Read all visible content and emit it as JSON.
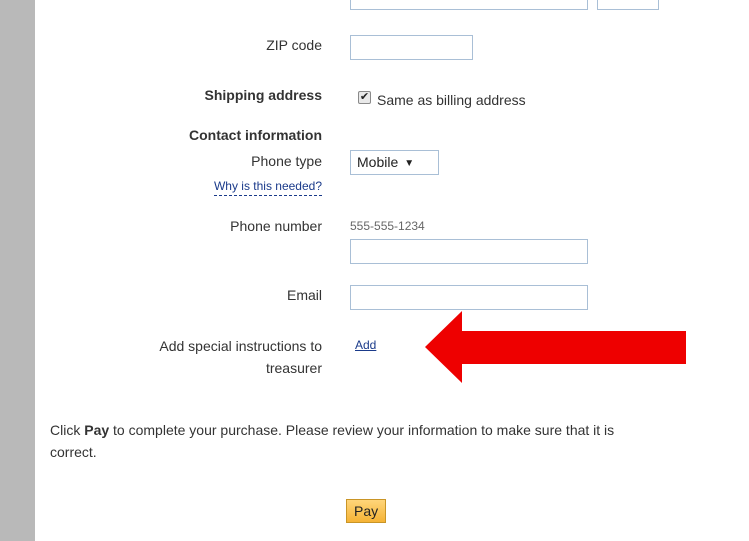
{
  "form": {
    "zip_label": "ZIP code",
    "zip_value": "",
    "shipping_label": "Shipping address",
    "shipping_checkbox_label": "Same as billing address",
    "shipping_checked": true,
    "contact_heading": "Contact information",
    "phone_type_label": "Phone type",
    "phone_type_value": "Mobile",
    "why_needed_link": "Why is this needed?",
    "phone_number_label": "Phone number",
    "phone_number_placeholder": "555-555-1234",
    "phone_number_value": "",
    "email_label": "Email",
    "email_value": "",
    "instructions_label_line1": "Add special instructions to",
    "instructions_label_line2": "treasurer",
    "instructions_link": "Add"
  },
  "footer": {
    "text_before": "Click ",
    "text_bold": "Pay",
    "text_after": " to complete your purchase. Please review your information to make sure that it is",
    "text_line2": "correct.",
    "pay_button": "Pay"
  },
  "annotation": {
    "arrow_color": "#ee0000"
  }
}
